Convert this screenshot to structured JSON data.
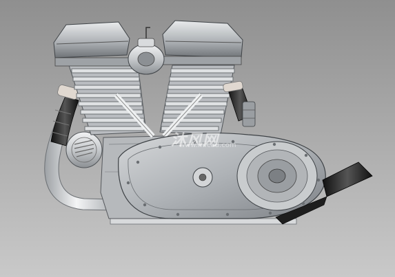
{
  "scene": {
    "subject": "v-twin-motorcycle-engine-cad-render",
    "colors": {
      "background_top": "#8f8f8f",
      "background_bottom": "#c9c9c9",
      "metal_light": "#e4e6e8",
      "metal_mid": "#b9bcc0",
      "metal_dark": "#55585c",
      "case": "#b0b3b6",
      "fin": "#d0d2d4",
      "pipe": "#d7dadd",
      "wrap": "#2a2a2a",
      "accent_red": "#c0262c"
    }
  },
  "watermark": {
    "logo_text": "沐风网",
    "url_text": "www.mfcad.com"
  }
}
